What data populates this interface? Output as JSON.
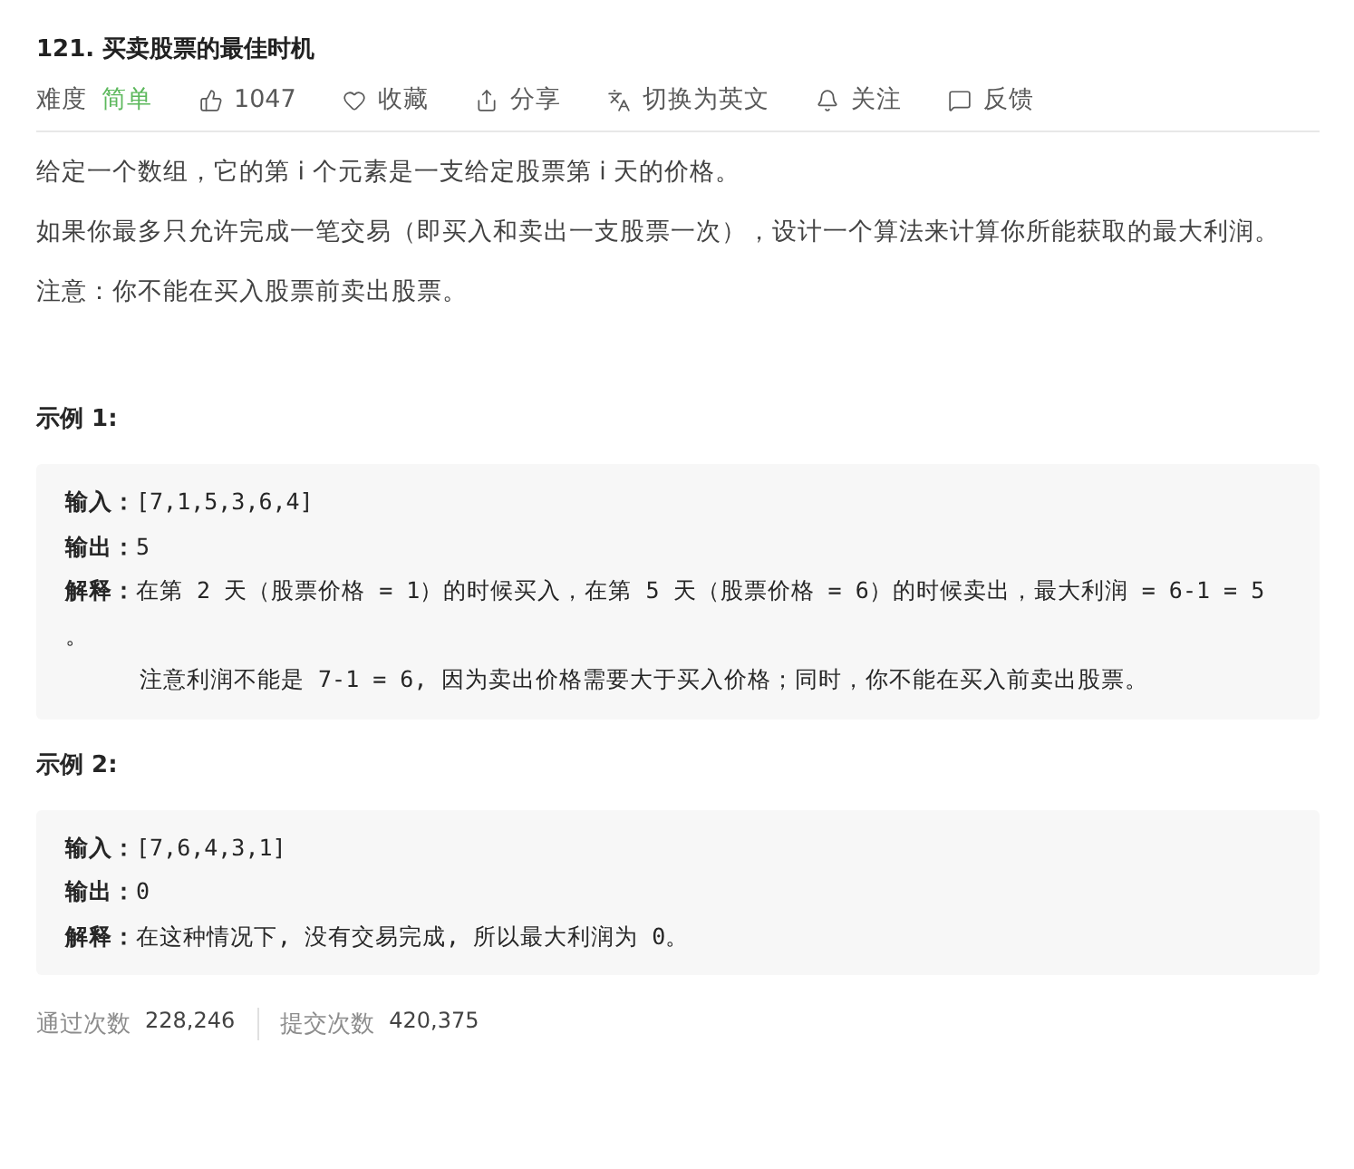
{
  "title": "121. 买卖股票的最佳时机",
  "toolbar": {
    "difficulty_label": "难度",
    "difficulty": "简单",
    "actions": [
      {
        "kind": "like",
        "label": "1047"
      },
      {
        "kind": "favorite",
        "label": "收藏"
      },
      {
        "kind": "share",
        "label": "分享"
      },
      {
        "kind": "translate",
        "label": "切换为英文"
      },
      {
        "kind": "follow",
        "label": "关注"
      },
      {
        "kind": "feedback",
        "label": "反馈"
      }
    ]
  },
  "description": [
    "给定一个数组，它的第 i 个元素是一支给定股票第 i 天的价格。",
    "如果你最多只允许完成一笔交易（即买入和卖出一支股票一次），设计一个算法来计算你所能获取的最大利润。",
    "注意：你不能在买入股票前卖出股票。"
  ],
  "examples": [
    {
      "heading": "示例 1:",
      "lines": [
        {
          "kind": "field",
          "label": "输入：",
          "text": "[7,1,5,3,6,4]"
        },
        {
          "kind": "field",
          "label": "输出：",
          "text": "5"
        },
        {
          "kind": "field",
          "label": "解释：",
          "text": "在第 2 天（股票价格 = 1）的时候买入，在第 5 天（股票价格 = 6）的时候卖出，最大利润 = 6-1 = 5 。"
        },
        {
          "kind": "note",
          "text": "注意利润不能是 7-1 = 6, 因为卖出价格需要大于买入价格；同时，你不能在买入前卖出股票。"
        }
      ]
    },
    {
      "heading": "示例 2:",
      "lines": [
        {
          "kind": "field",
          "label": "输入：",
          "text": "[7,6,4,3,1]"
        },
        {
          "kind": "field",
          "label": "输出：",
          "text": "0"
        },
        {
          "kind": "field",
          "label": "解释：",
          "text": "在这种情况下, 没有交易完成, 所以最大利润为 0。"
        }
      ]
    }
  ],
  "stats": [
    {
      "label": "通过次数",
      "value": "228,246"
    },
    {
      "label": "提交次数",
      "value": "420,375"
    }
  ]
}
